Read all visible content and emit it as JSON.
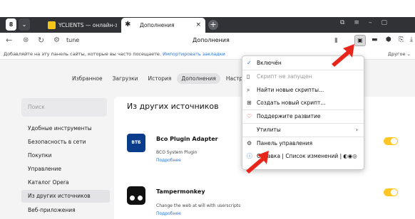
{
  "browser": {
    "tab_count": "8",
    "tabs": [
      {
        "title": "YCLIENTS — онлайн-запис",
        "close": "×"
      },
      {
        "title": "Дополнения",
        "close": "×"
      }
    ],
    "new_tab": "+",
    "address": "tune",
    "page_title": "Дополнения"
  },
  "bookmarks": {
    "hint": "Добавляйте на эту панель сайты, которые вы часто посещаете.",
    "import_link": "Импортировать закладки",
    "other": "Другое ⌄"
  },
  "subnav": {
    "items": [
      "Избранное",
      "Загрузки",
      "История",
      "Дополнения",
      "Настройки"
    ]
  },
  "sidebar": {
    "search_placeholder": "Поиск",
    "items": [
      "Удобные инструменты",
      "Безопасность в сети",
      "Покупки",
      "Управление",
      "Каталог Opera",
      "Из других источников",
      "Веб-приложения"
    ]
  },
  "main": {
    "title": "Из других источников",
    "extensions": [
      {
        "name": "Bco Plugin Adapter",
        "desc": "BCO System Plugin",
        "more": "Подробнее",
        "icon_text": "ВТБ",
        "enabled": true
      },
      {
        "name": "Tampermonkey",
        "desc": "Change the web at will with userscripts",
        "more": "Подробнее",
        "enabled": true
      }
    ]
  },
  "menu": {
    "items": [
      {
        "label": "Включён",
        "icon": "check-icon",
        "enabled": true
      },
      {
        "label": "Скрипт не запущен",
        "icon": "script-icon",
        "enabled": false
      },
      {
        "label": "Найти новые скрипты...",
        "icon": "search-icon",
        "enabled": true
      },
      {
        "label": "Создать новый скрипт...",
        "icon": "add-icon",
        "enabled": true
      },
      {
        "label": "Поддержите развитие",
        "icon": "heart-icon",
        "enabled": true
      },
      {
        "label": "Утилиты",
        "icon": "",
        "enabled": true,
        "submenu": true
      },
      {
        "label": "Панель управления",
        "icon": "gear-icon",
        "enabled": true
      }
    ],
    "footer": "Справка | Список изменений |"
  },
  "colors": {
    "accent_yellow": "#ffc626",
    "arrow_red": "#e8251b",
    "link_blue": "#2a73d9"
  }
}
